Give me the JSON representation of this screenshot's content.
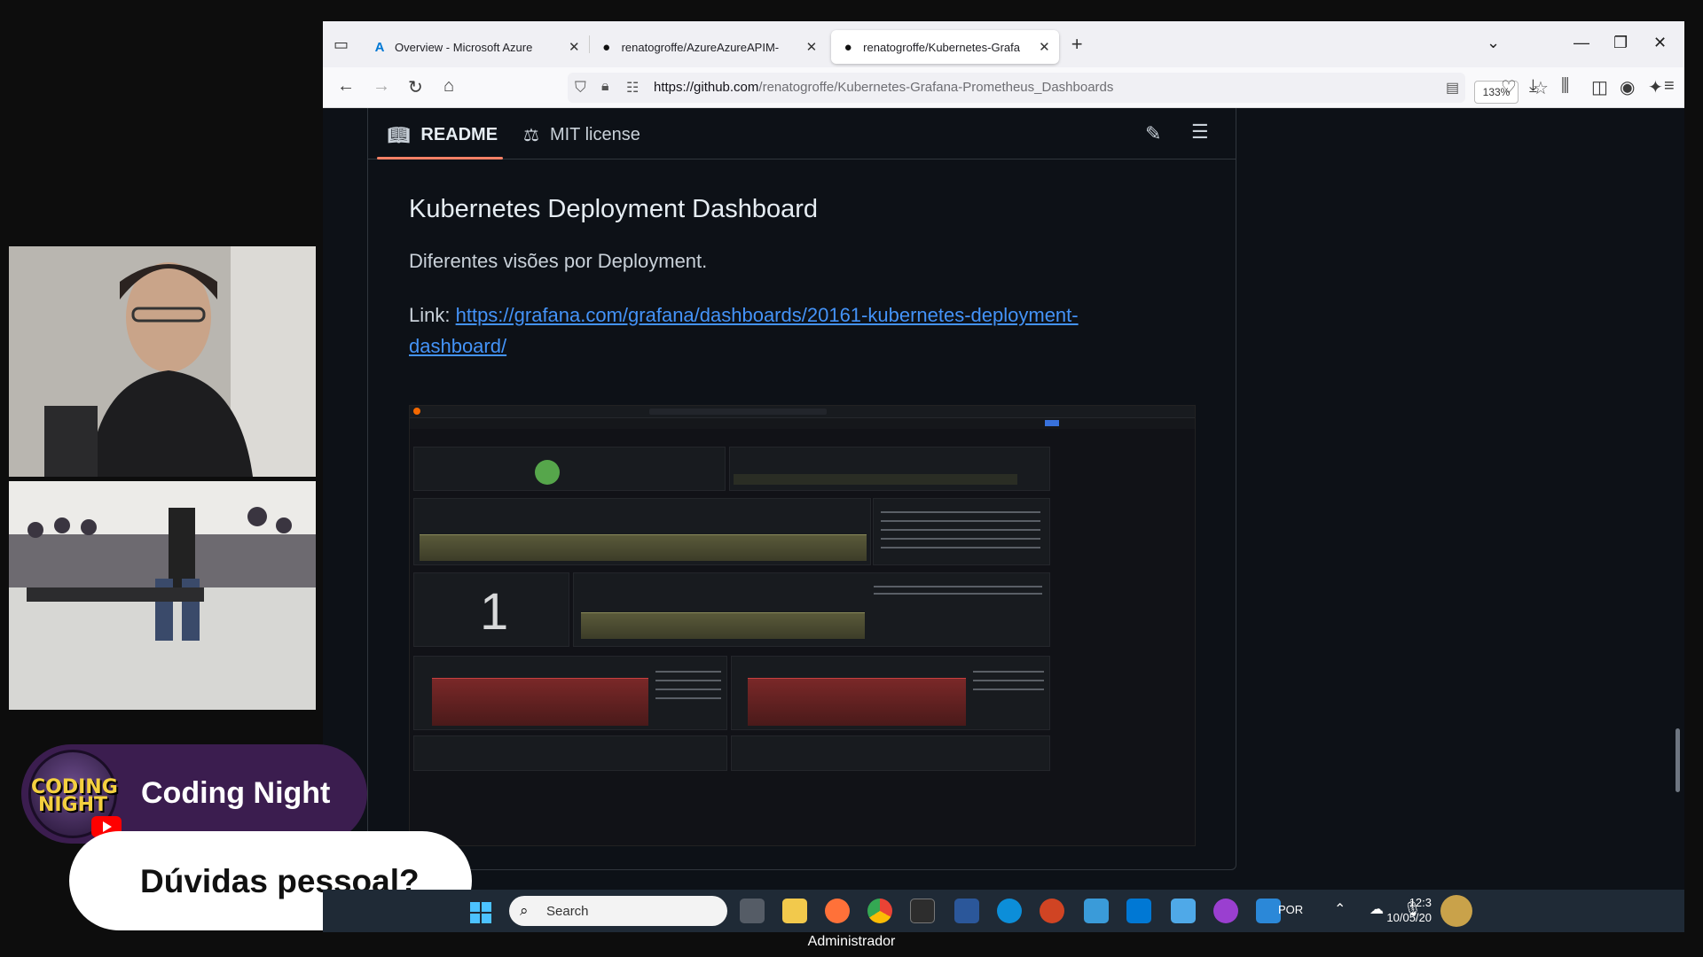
{
  "browser": {
    "tabs": [
      {
        "label": "Overview - Microsoft Azure",
        "icon": "azure-icon",
        "active": false
      },
      {
        "label": "renatogroffe/AzureAzureAPIM-",
        "icon": "github-icon",
        "active": false
      },
      {
        "label": "renatogroffe/Kubernetes-Grafa",
        "icon": "github-icon",
        "active": true
      }
    ],
    "url_host": "https://github.com",
    "url_path": "/renatogroffe/Kubernetes-Grafana-Prometheus_Dashboards",
    "zoom": "133%"
  },
  "readme": {
    "tab_readme": "README",
    "tab_license": "MIT license",
    "title": "Kubernetes Deployment Dashboard",
    "description": "Diferentes visões por Deployment.",
    "link_label": "Link:",
    "link_url": "https://grafana.com/grafana/dashboards/20161-kubernetes-deployment-dashboard/"
  },
  "grafana_preview": {
    "big_number": "1"
  },
  "overlay": {
    "channel_logo_text": "CODING NIGHT",
    "channel_name": "Coding Night",
    "question": "Dúvidas pessoal?"
  },
  "taskbar": {
    "search_placeholder": "Search",
    "language": "POR",
    "time": "12:3",
    "date": "10/05/20"
  },
  "footer_label": "Administrador",
  "colors": {
    "github_bg": "#0d1117",
    "link": "#4493f8",
    "tab_underline": "#f78166",
    "overlay_purple": "#3b1d4f"
  }
}
